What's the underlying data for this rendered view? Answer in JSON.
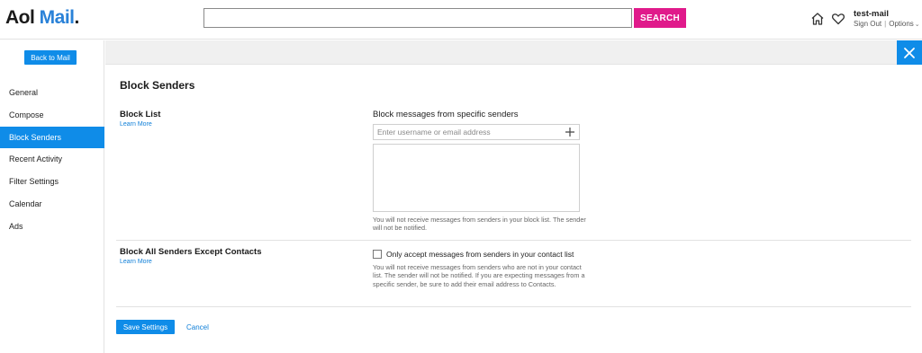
{
  "header": {
    "logo_aol": "Aol",
    "logo_mail": "Mail",
    "logo_dot": ".",
    "search_value": "",
    "search_placeholder": "",
    "search_button": "SEARCH",
    "user_name": "test-mail",
    "sign_out": "Sign Out",
    "options": "Options",
    "icons": [
      "home-icon",
      "heart-icon",
      "chevron-down-icon"
    ]
  },
  "sidebar": {
    "back_button": "Back to Mail",
    "items": [
      {
        "label": "General",
        "active": false
      },
      {
        "label": "Compose",
        "active": false
      },
      {
        "label": "Block Senders",
        "active": true
      },
      {
        "label": "Recent Activity",
        "active": false
      },
      {
        "label": "Filter Settings",
        "active": false
      },
      {
        "label": "Calendar",
        "active": false
      },
      {
        "label": "Ads",
        "active": false
      }
    ]
  },
  "main": {
    "title": "Block Senders",
    "block_list": {
      "title": "Block List",
      "learn_more": "Learn More",
      "field_label": "Block messages from specific senders",
      "input_value": "",
      "input_placeholder": "Enter username or email address",
      "note": "You will not receive messages from senders in your block list. The sender will not be notified."
    },
    "block_all": {
      "title": "Block All Senders Except Contacts",
      "learn_more": "Learn More",
      "checkbox_label": "Only accept messages from senders in your contact list",
      "checked": false,
      "note": "You will not receive messages from senders who are not in your contact list. The sender will not be notified. If you are expecting messages from a specific sender, be sure to add their email address to Contacts."
    },
    "save_button": "Save Settings",
    "cancel_link": "Cancel"
  },
  "colors": {
    "accent_blue": "#0f8ce8",
    "search_pink": "#e01a8b",
    "link_blue": "#0f7fd8",
    "logo_blue": "#2a82d8"
  }
}
